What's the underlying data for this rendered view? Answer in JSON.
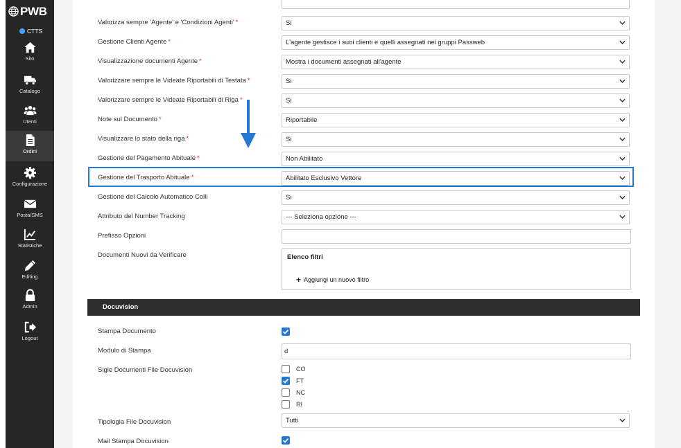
{
  "brand": {
    "name": "PWB",
    "status": "CTTS"
  },
  "sidebar": {
    "items": [
      {
        "label": "Sito",
        "icon": "home-icon"
      },
      {
        "label": "Catalogo",
        "icon": "truck-icon"
      },
      {
        "label": "Utenti",
        "icon": "users-icon"
      },
      {
        "label": "Ordini",
        "icon": "document-icon",
        "active": true
      },
      {
        "label": "Configurazione",
        "icon": "gear-icon"
      },
      {
        "label": "Posta/SMS",
        "icon": "envelope-icon"
      },
      {
        "label": "Statistiche",
        "icon": "chart-icon"
      },
      {
        "label": "Editing",
        "icon": "pencil-icon"
      },
      {
        "label": "Admin",
        "icon": "lock-icon"
      },
      {
        "label": "Logout",
        "icon": "logout-icon"
      }
    ]
  },
  "form": {
    "rows": [
      {
        "label": "Valorizza sempre 'Agente' e 'Condizioni Agenti'",
        "required": "*",
        "value": "Si"
      },
      {
        "label": "Gestione Clienti Agente",
        "required": "*",
        "value": "L'agente gestisce i suoi clienti e quelli assegnati nei gruppi Passweb"
      },
      {
        "label": "Visualizzazione documenti Agente",
        "required": "*",
        "value": "Mostra i documenti assegnati all'agente"
      },
      {
        "label": "Valorizzare sempre le Videate Riportabili di Testata",
        "required": "*",
        "value": "Si"
      },
      {
        "label": "Valorizzare sempre le Videate Riportabili di Riga",
        "required": "*",
        "value": "Si"
      },
      {
        "label": "Note sul Documento",
        "required": "*",
        "value": "Riportabile"
      },
      {
        "label": "Visualizzare lo stato della riga",
        "required": "*",
        "value": "Si"
      },
      {
        "label": "Gestione del Pagamento Abituale",
        "required": "*",
        "value": "Non Abilitato"
      },
      {
        "label": "Gestione del Trasporto Abituale",
        "required": "*",
        "value": "Abilitato Esclusivo Vettore"
      },
      {
        "label": "Gestione del Calcolo Automatico Colli",
        "required": "",
        "value": "Si"
      },
      {
        "label": "Attributo del Number Tracking",
        "required": "",
        "value": "--- Seleziona opzione ---"
      }
    ],
    "prefisso_label": "Prefisso Opzioni",
    "prefisso_value": "",
    "documenti_label": "Documenti Nuovi da Verificare",
    "filter_title": "Elenco filtri",
    "filter_add": "Aggiungi un nuovo filtro"
  },
  "docuvision": {
    "header": "Docuvision",
    "stampa_label": "Stampa Documento",
    "stampa_checked": true,
    "modulo_label": "Modulo di Stampa",
    "modulo_value": "d",
    "sigle_label": "Sigle Documenti File Docuvision",
    "sigle": [
      {
        "code": "CO",
        "checked": false
      },
      {
        "code": "FT",
        "checked": true
      },
      {
        "code": "NC",
        "checked": false
      },
      {
        "code": "RI",
        "checked": false
      }
    ],
    "tipologia_label": "Tipologia File Docuvision",
    "tipologia_value": "Tutti",
    "mail_label": "Mail Stampa Docuvision",
    "mail_checked": true
  },
  "colors": {
    "accent": "#2478d4",
    "sidebar": "#262626",
    "required": "#d9342b"
  }
}
